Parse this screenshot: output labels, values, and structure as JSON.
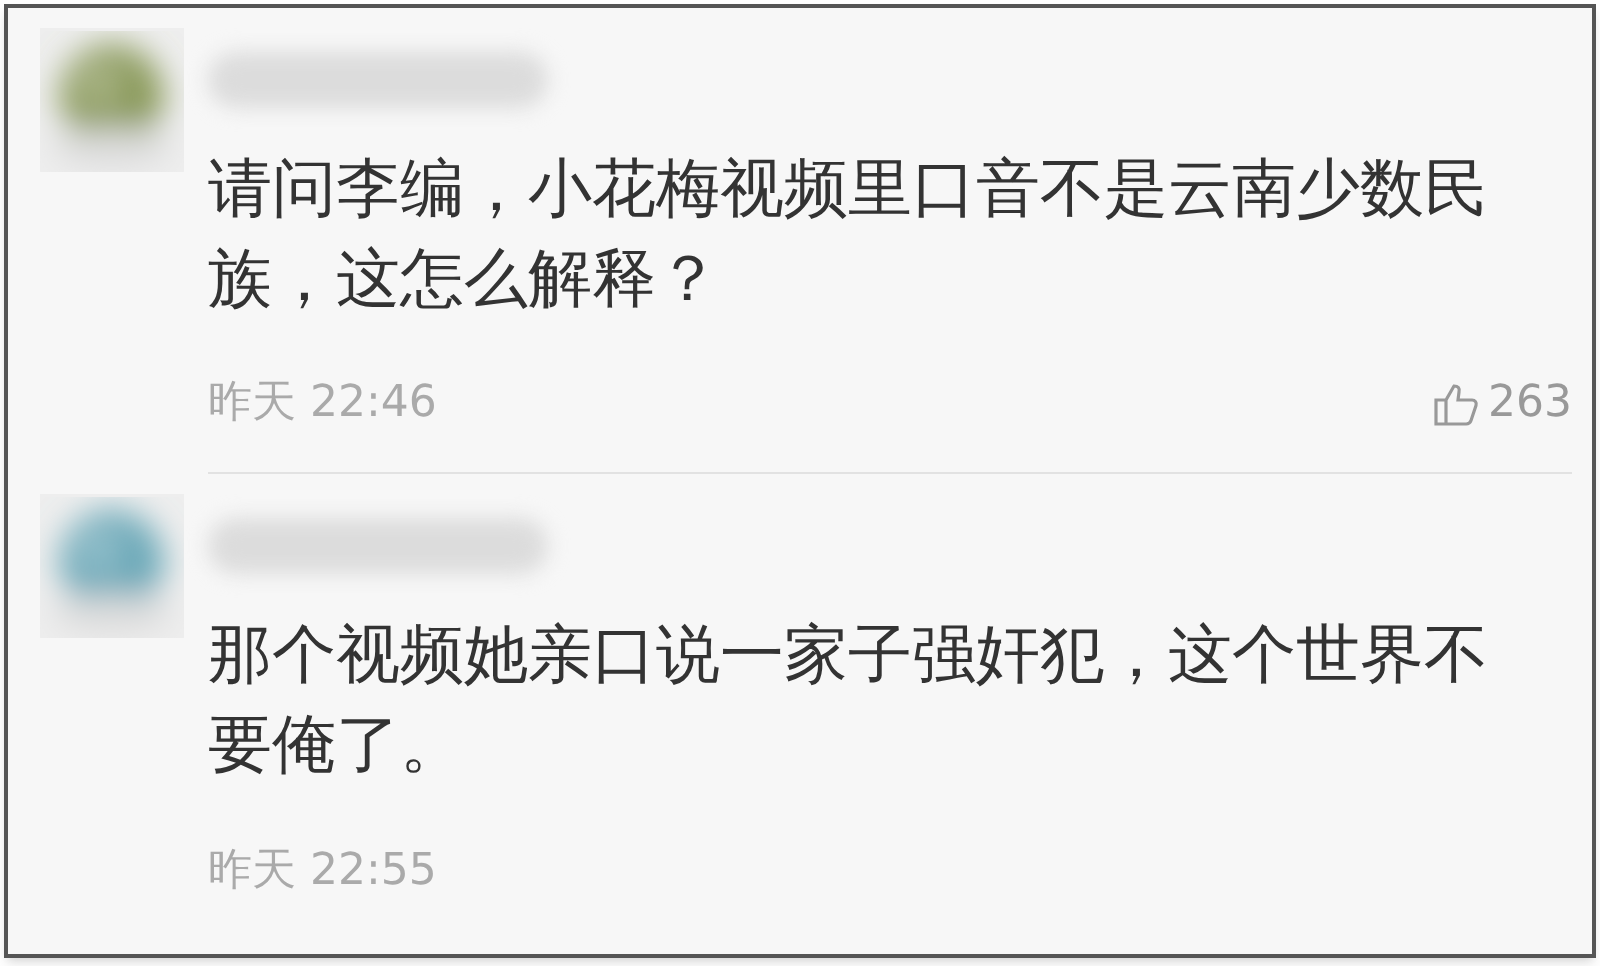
{
  "comments": [
    {
      "text": "请问李编，小花梅视频里口音不是云南少数民族，这怎么解释？",
      "time": "昨天 22:46",
      "likes": "263"
    },
    {
      "text": "那个视频她亲口说一家子强奸犯，这个世界不要俺了。",
      "time": "昨天 22:55"
    }
  ]
}
